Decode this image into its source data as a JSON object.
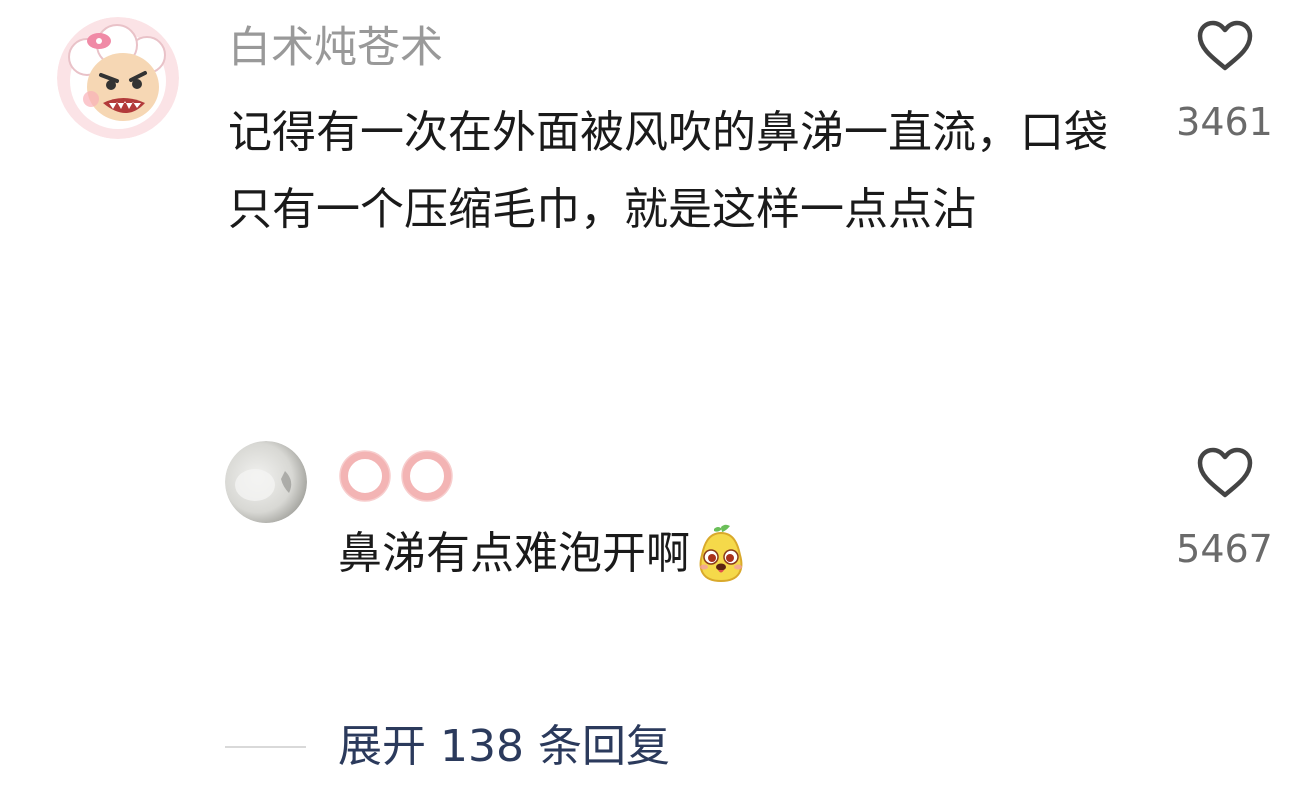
{
  "comment": {
    "username": "白术炖苍术",
    "text": "记得有一次在外面被风吹的鼻涕一直流，口袋只有一个压缩毛巾，就是这样一点点沾",
    "like_count": "3461",
    "avatar_icon": "cartoon-sheep-avatar"
  },
  "reply": {
    "username_icons": [
      "pink-ring-icon",
      "pink-ring-icon"
    ],
    "text": "鼻涕有点难泡开啊",
    "emoji_icon": "smiling-pear-emoji",
    "like_count": "5467",
    "avatar_icon": "white-cat-avatar"
  },
  "expand": {
    "label": "展开 138 条回复"
  },
  "colors": {
    "username": "#999999",
    "text": "#1a1a1a",
    "like_count": "#6a6a6a",
    "expand_link": "#2b3a5c",
    "ring": "#f3b4b4"
  }
}
